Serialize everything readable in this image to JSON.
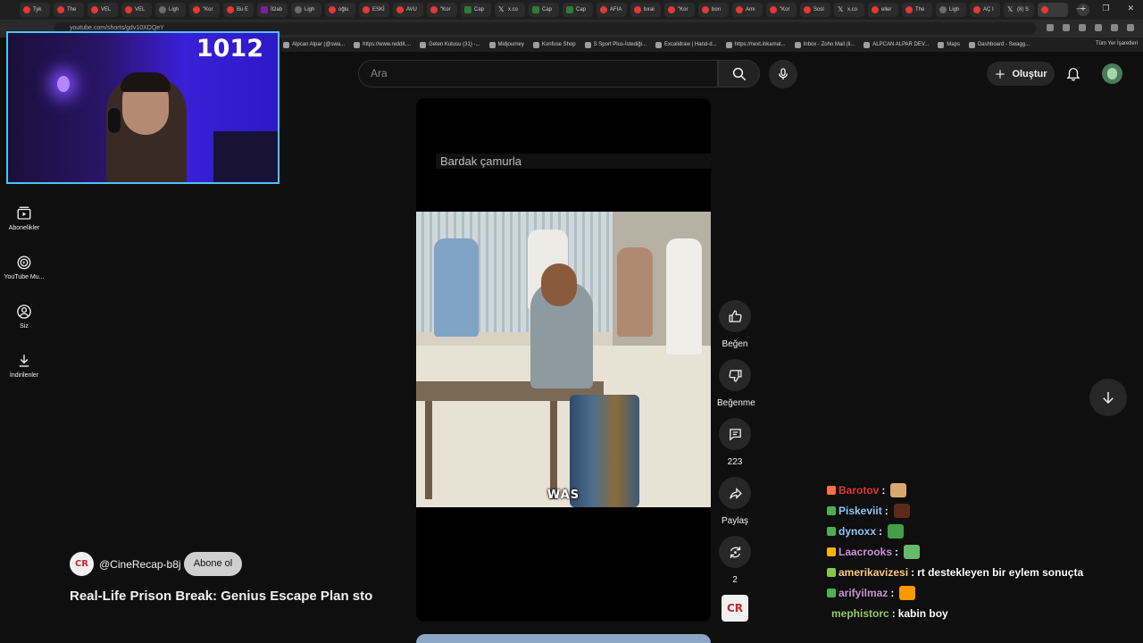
{
  "tabs": [
    {
      "label": "Tyk",
      "icon": "youtube-icon"
    },
    {
      "label": "The",
      "icon": "youtube-icon"
    },
    {
      "label": "VEL",
      "icon": "youtube-icon"
    },
    {
      "label": "VEL",
      "icon": "youtube-icon"
    },
    {
      "label": "Ligh",
      "icon": "link-icon"
    },
    {
      "label": "\"Kor",
      "icon": "youtube-icon"
    },
    {
      "label": "Bu E",
      "icon": "youtube-icon"
    },
    {
      "label": "İl2ab",
      "icon": "hashtag-icon"
    },
    {
      "label": "Ligh",
      "icon": "link-icon"
    },
    {
      "label": "oğlu",
      "icon": "youtube-icon"
    },
    {
      "label": "ESKİ",
      "icon": "youtube-icon"
    },
    {
      "label": "AVU",
      "icon": "youtube-icon"
    },
    {
      "label": "\"Kor",
      "icon": "youtube-icon"
    },
    {
      "label": "Cap",
      "icon": "k-icon"
    },
    {
      "label": "x.co",
      "icon": "x-icon"
    },
    {
      "label": "Cap",
      "icon": "k-icon"
    },
    {
      "label": "Cap",
      "icon": "k-icon"
    },
    {
      "label": "AFIA",
      "icon": "youtube-icon"
    },
    {
      "label": "bırai",
      "icon": "youtube-icon"
    },
    {
      "label": "\"Kor",
      "icon": "youtube-icon"
    },
    {
      "label": "borı",
      "icon": "youtube-icon"
    },
    {
      "label": "Amı",
      "icon": "youtube-icon"
    },
    {
      "label": "\"Kor",
      "icon": "youtube-icon"
    },
    {
      "label": "Sosl",
      "icon": "youtube-icon"
    },
    {
      "label": "x.co",
      "icon": "x-icon"
    },
    {
      "label": "eller",
      "icon": "youtube-icon"
    },
    {
      "label": "The",
      "icon": "youtube-icon"
    },
    {
      "label": "Ligh",
      "icon": "link-icon"
    },
    {
      "label": "AÇ I",
      "icon": "youtube-icon"
    },
    {
      "label": "(8) S",
      "icon": "x-icon"
    }
  ],
  "address": {
    "url": "youtube.com/shorts/gdv10XDQeY"
  },
  "bookmarks": [
    "Alpcan Alpar (@swa...",
    "https://www.reddit....",
    "Gelen Kutusu (31) -...",
    "Midjourney",
    "Konfuse Shop",
    "S Sport Plus-İstediği...",
    "Excalidraw | Hand-d...",
    "https://next.inkamat...",
    "Inbox - Zoho Mail (li...",
    "ALPCAN ALPAR DEV...",
    "Maps",
    "Dashboard - Swagg..."
  ],
  "bookmarks_other": "Tüm Yer İşaretleri",
  "webcam": {
    "counter": "1012"
  },
  "sidebar": [
    {
      "label": "Abonelikler",
      "icon": "subscriptions-icon"
    },
    {
      "label": "YouTube Mu...",
      "icon": "youtube-music-icon"
    },
    {
      "label": "Siz",
      "icon": "profile-icon"
    },
    {
      "label": "İndirilenler",
      "icon": "download-icon"
    }
  ],
  "search": {
    "placeholder": "Ara"
  },
  "header": {
    "create_label": "Oluştur"
  },
  "video": {
    "caption": "Bardak çamurla",
    "subtitle": "WAS"
  },
  "actions": {
    "like": "Beğen",
    "dislike": "Beğenme",
    "comments": "223",
    "share": "Paylaş",
    "remix": "2"
  },
  "channel": {
    "handle": "@CineRecap-b8j",
    "avatar_text": "CR",
    "subscribe_label": "Abone ol",
    "title": "Real-Life Prison Break: Genius Escape Plan stor..."
  },
  "chat": [
    {
      "user": "Barotov",
      "message": "",
      "color": "#e53935",
      "badge_color": "#ff7043",
      "emote_color": "#d7a86e"
    },
    {
      "user": "Piskeviit",
      "message": "",
      "color": "#90caf9",
      "badge_color": "#4caf50",
      "emote_color": "#5d2a1a"
    },
    {
      "user": "dynoxx",
      "message": "",
      "color": "#90caf9",
      "badge_color": "#4caf50",
      "emote_color": "#43a047"
    },
    {
      "user": "Laacrooks",
      "message": "",
      "color": "#ce93d8",
      "badge_color": "#ffb300",
      "emote_color": "#66bb6a"
    },
    {
      "user": "amerikavizesi",
      "message": "rt destekleyen bir eylem sonuçta",
      "color": "#ffcc80",
      "badge_color": "#8bc34a",
      "emote_color": ""
    },
    {
      "user": "arifyilmaz",
      "message": "",
      "color": "#ce93d8",
      "badge_color": "#4caf50",
      "emote_color": "#ff9800"
    },
    {
      "user": "mephistorc",
      "message": "kabin boy",
      "color": "#9ccc65",
      "badge_color": "",
      "emote_color": ""
    }
  ],
  "colors": {
    "background": "#0f0f0f",
    "webcam_border": "#4fc3f7",
    "youtube_red": "#e53935"
  }
}
